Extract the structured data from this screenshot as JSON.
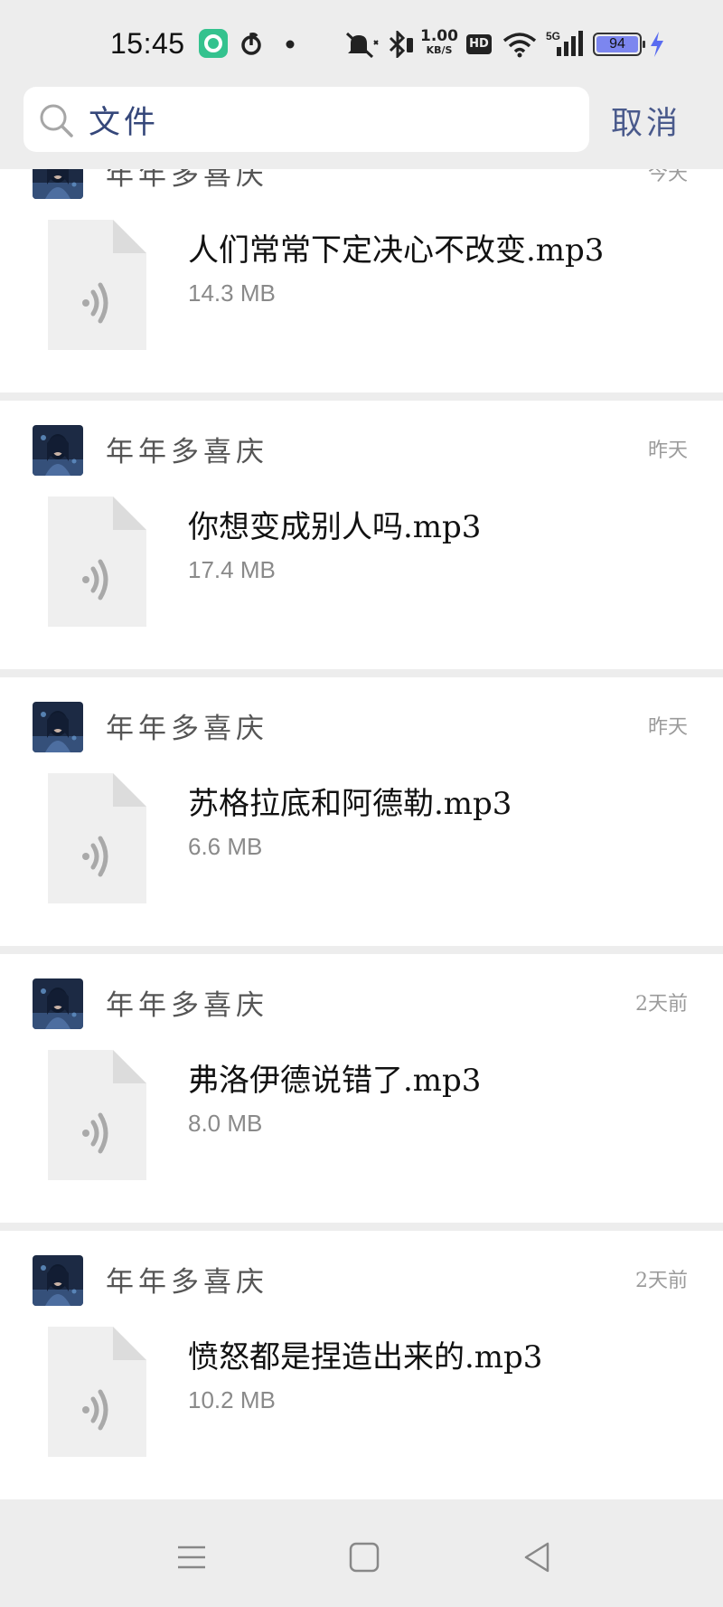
{
  "status_bar": {
    "time": "15:45",
    "net_speed_value": "1.00",
    "net_speed_unit": "KB/S",
    "hd_label": "HD",
    "network_label": "5G",
    "battery_level": "94",
    "icons": [
      "app-icon",
      "netease-music-icon",
      "dot-icon",
      "mute-icon",
      "bluetooth-icon",
      "hd-icon",
      "wifi-icon",
      "signal-icon",
      "battery-icon",
      "charging-icon"
    ],
    "colors": {
      "app_icon": "#34c28e",
      "battery_fill": "#7c86ef",
      "charging": "#5a6cf0"
    }
  },
  "search": {
    "query": "文件",
    "cancel_label": "取消",
    "accent_color": "#4a5a8c"
  },
  "files": [
    {
      "sender": "年年多喜庆",
      "date": "今天",
      "name": "人们常常下定决心不改变.mp3",
      "size": "14.3 MB"
    },
    {
      "sender": "年年多喜庆",
      "date": "昨天",
      "name": "你想变成别人吗.mp3",
      "size": "17.4 MB"
    },
    {
      "sender": "年年多喜庆",
      "date": "昨天",
      "name": "苏格拉底和阿德勒.mp3",
      "size": "6.6 MB"
    },
    {
      "sender": "年年多喜庆",
      "date": "2天前",
      "name": "弗洛伊德说错了.mp3",
      "size": "8.0 MB"
    },
    {
      "sender": "年年多喜庆",
      "date": "2天前",
      "name": "愤怒都是捏造出来的.mp3",
      "size": "10.2 MB"
    }
  ],
  "nav_bar": {
    "icons": [
      "menu-icon",
      "home-icon",
      "back-icon"
    ]
  }
}
